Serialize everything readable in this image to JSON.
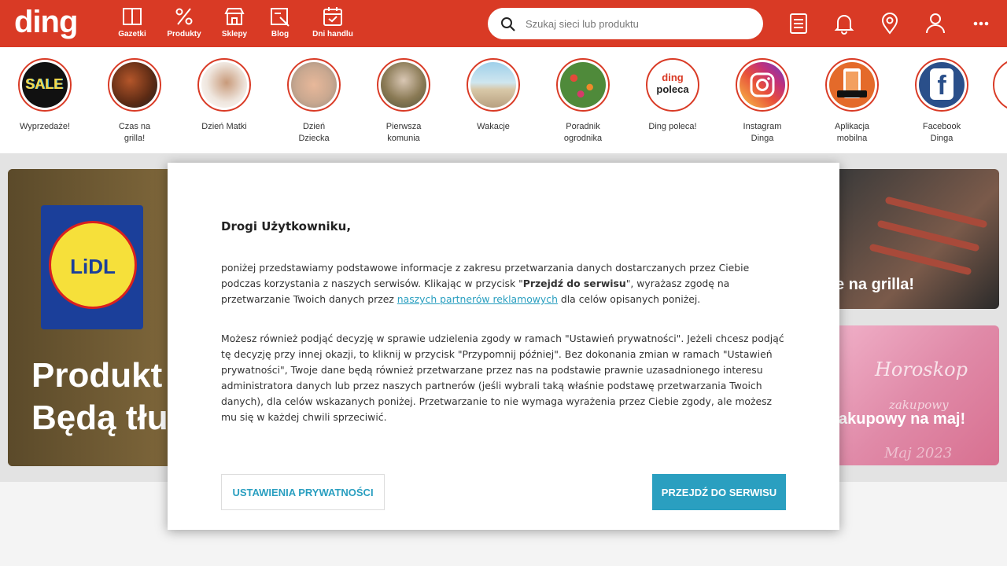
{
  "header": {
    "logo": "ding",
    "nav": [
      {
        "label": "Gazetki",
        "icon": "flyer-icon"
      },
      {
        "label": "Produkty",
        "icon": "percent-icon"
      },
      {
        "label": "Sklepy",
        "icon": "store-icon"
      },
      {
        "label": "Blog",
        "icon": "blog-icon"
      },
      {
        "label": "Dni handlu",
        "icon": "calendar-icon"
      }
    ],
    "search_placeholder": "Szukaj sieci lub produktu",
    "icons": [
      "list-icon",
      "bell-icon",
      "location-pin-icon",
      "user-icon",
      "more-icon"
    ]
  },
  "stories": [
    {
      "label": "Wyprzedaże!"
    },
    {
      "label": "Czas na grilla!"
    },
    {
      "label": "Dzień Matki"
    },
    {
      "label": "Dzień Dziecka"
    },
    {
      "label": "Pierwsza komunia"
    },
    {
      "label": "Wakacje"
    },
    {
      "label": "Poradnik ogrodnika"
    },
    {
      "label": "Ding poleca!"
    },
    {
      "label": "Instagram Dinga"
    },
    {
      "label": "Aplikacja mobilna"
    },
    {
      "label": "Facebook Dinga"
    }
  ],
  "story_badges": {
    "sale": "SALE",
    "ding": "ding",
    "poleca": "poleca",
    "lidl": "LiDL",
    "facebook": "f"
  },
  "hero": {
    "main_line1": "Produkt",
    "main_line2": "Będą tłu",
    "card1": "e na grilla!",
    "card2": "akupowy na maj!",
    "card2_art1": "Horoskop",
    "card2_art2": "zakupowy",
    "card2_art3": "Maj 2023"
  },
  "modal": {
    "title": "Drogi Użytkowniku,",
    "p1_a": "poniżej przedstawiamy podstawowe informacje z zakresu przetwarzania danych dostarczanych przez Ciebie podczas korzystania z naszych serwisów. Klikając w przycisk \"",
    "p1_bold": "Przejdź do serwisu",
    "p1_b": "\", wyrażasz zgodę na przetwarzanie Twoich danych przez ",
    "p1_link": "naszych partnerów reklamowych",
    "p1_c": " dla celów opisanych poniżej.",
    "p2": "Możesz również podjąć decyzję w sprawie udzielenia zgody w ramach \"Ustawień prywatności\". Jeżeli chcesz podjąć tę decyzję przy innej okazji, to kliknij w przycisk \"Przypomnij później\". Bez dokonania zmian w ramach \"Ustawień prywatności\", Twoje dane będą również przetwarzane przez nas na podstawie prawnie uzasadnionego interesu administratora danych lub przez naszych partnerów (jeśli wybrali taką właśnie podstawę przetwarzania Twoich danych), dla celów wskazanych poniżej. Przetwarzanie to nie wymaga wyrażenia przez Ciebie zgody, ale możesz mu się w każdej chwili sprzeciwić.",
    "btn_settings": "USTAWIENIA PRYWATNOŚCI",
    "btn_go": "PRZEJDŹ DO SERWISU"
  },
  "colors": {
    "brand": "#d93a25",
    "accent": "#2a9fc0"
  }
}
